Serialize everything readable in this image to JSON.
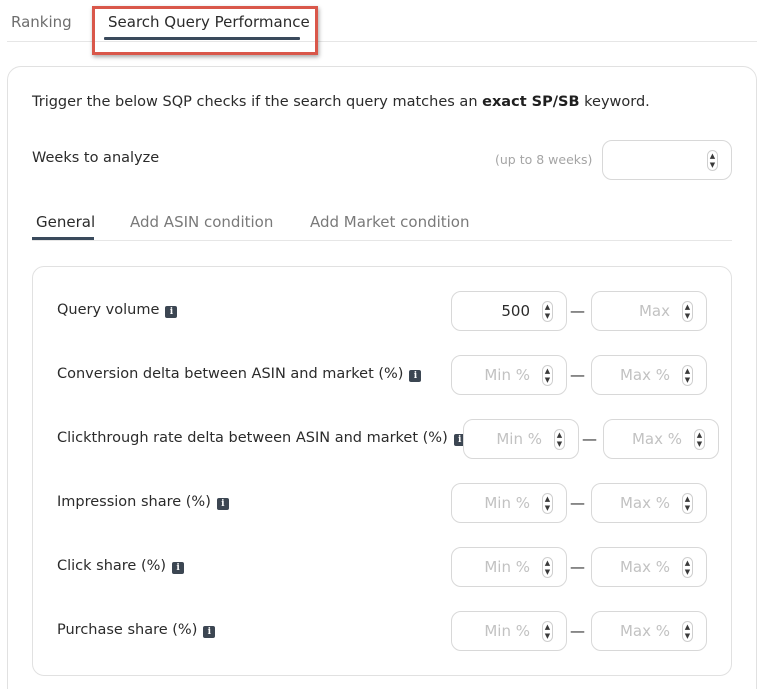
{
  "tabs": {
    "ranking": "Ranking",
    "sqp": "Search Query Performance"
  },
  "intro": {
    "pre": "Trigger the below SQP checks if the search query matches an ",
    "bold": "exact SP/SB",
    "post": " keyword."
  },
  "weeks": {
    "label": "Weeks to analyze",
    "hint": "(up to 8 weeks)",
    "value": ""
  },
  "subtabs": {
    "general": "General",
    "asin": "Add ASIN condition",
    "market": "Add Market condition"
  },
  "icons": {
    "info": "i",
    "up": "▲",
    "down": "▼",
    "dash": "—"
  },
  "rows": [
    {
      "label": "Query volume",
      "min_value": "500",
      "min_placeholder": "",
      "max_placeholder": "Max"
    },
    {
      "label": "Conversion delta between ASIN and market (%)",
      "min_value": "",
      "min_placeholder": "Min %",
      "max_placeholder": "Max %"
    },
    {
      "label": "Clickthrough rate delta between ASIN and market (%)",
      "min_value": "",
      "min_placeholder": "Min %",
      "max_placeholder": "Max %"
    },
    {
      "label": "Impression share (%)",
      "min_value": "",
      "min_placeholder": "Min %",
      "max_placeholder": "Max %"
    },
    {
      "label": "Click share (%)",
      "min_value": "",
      "min_placeholder": "Min %",
      "max_placeholder": "Max %"
    },
    {
      "label": "Purchase share (%)",
      "min_value": "",
      "min_placeholder": "Min %",
      "max_placeholder": "Max %"
    }
  ],
  "colors": {
    "accent": "#3a4a5c",
    "highlight": "#d9574a",
    "info_icon": "#3c4652"
  }
}
